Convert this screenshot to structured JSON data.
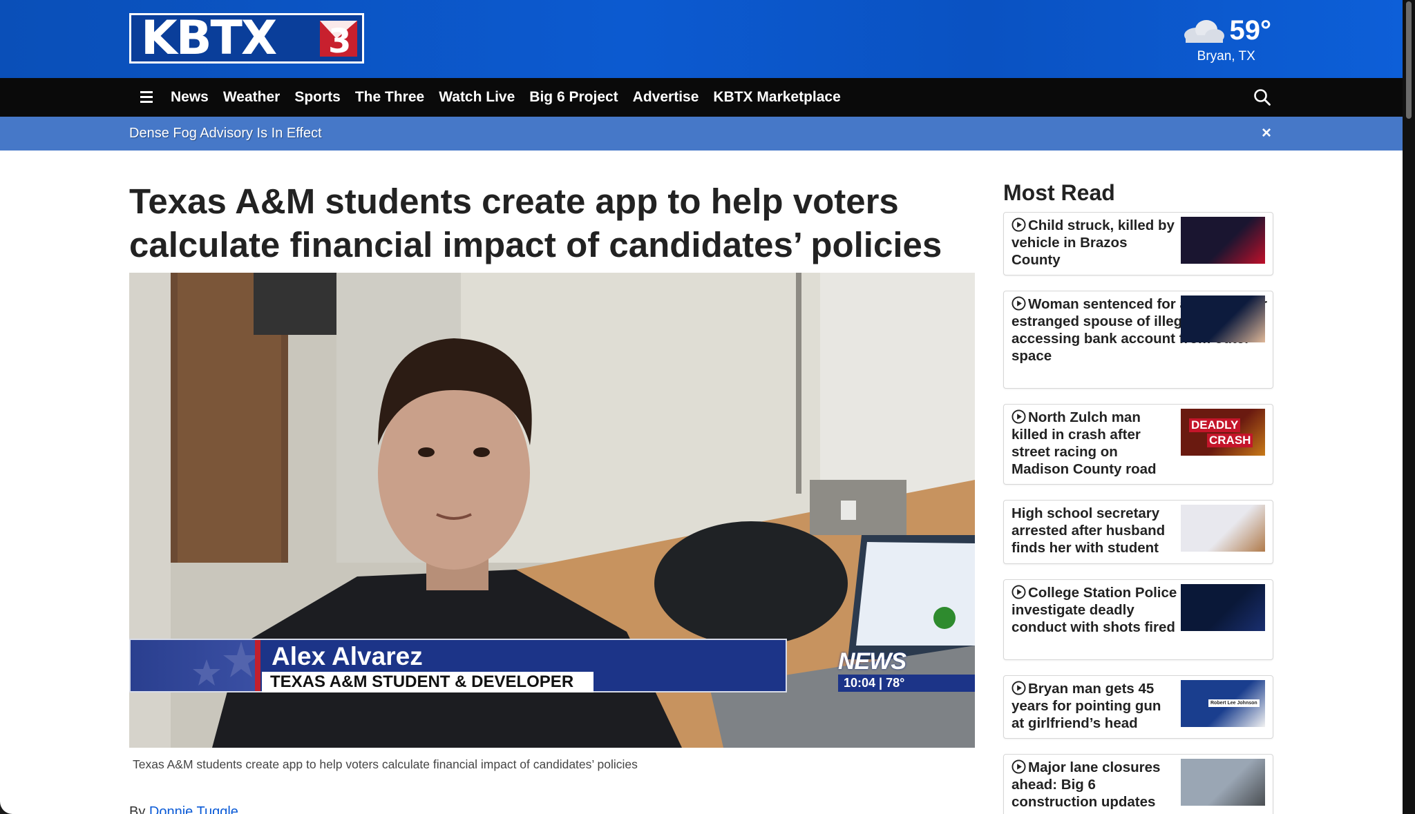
{
  "header": {
    "logo_text": "KBTX",
    "weather": {
      "temp": "59°",
      "location": "Bryan, TX",
      "icon": "cloud-icon"
    }
  },
  "nav": {
    "items": [
      {
        "label": "News"
      },
      {
        "label": "Weather"
      },
      {
        "label": "Sports"
      },
      {
        "label": "The Three"
      },
      {
        "label": "Watch Live"
      },
      {
        "label": "Big 6 Project"
      },
      {
        "label": "Advertise"
      },
      {
        "label": "KBTX Marketplace"
      }
    ]
  },
  "alert": {
    "text": "Dense Fog Advisory Is In Effect",
    "close": "×"
  },
  "article": {
    "headline": "Texas A&M students create app to help voters calculate financial impact of candidates’ policies",
    "caption": "Texas A&M students create app to help voters calculate financial impact of candidates’ policies",
    "byline_prefix": "By ",
    "author": "Donnie Tuggle",
    "video_overlay": {
      "name": "Alex Alvarez",
      "title": "TEXAS A&M STUDENT & DEVELOPER",
      "bug_logo": "NEWS",
      "bug_info": "10:04 | 78°"
    }
  },
  "sidebar": {
    "title": "Most Read",
    "items": [
      {
        "title": "Child struck, killed by vehicle in Brazos County",
        "video": true
      },
      {
        "title": "Woman sentenced for accusing her estranged spouse of illegally accessing bank account from outer space",
        "video": true
      },
      {
        "title": "North Zulch man killed in crash after street racing on Madison County road",
        "video": true,
        "thumb_text_1": "DEADLY",
        "thumb_text_2": "CRASH"
      },
      {
        "title": "High school secretary arrested after husband finds her with student",
        "video": false
      },
      {
        "title": "College Station Police investigate deadly conduct with shots fired",
        "video": true
      },
      {
        "title": "Bryan man gets 45 years for pointing gun at girlfriend’s head",
        "video": true,
        "thumb_text_1": "Robert Lee Johnson"
      },
      {
        "title": "Major lane closures ahead: Big 6 construction updates",
        "video": true
      }
    ]
  }
}
